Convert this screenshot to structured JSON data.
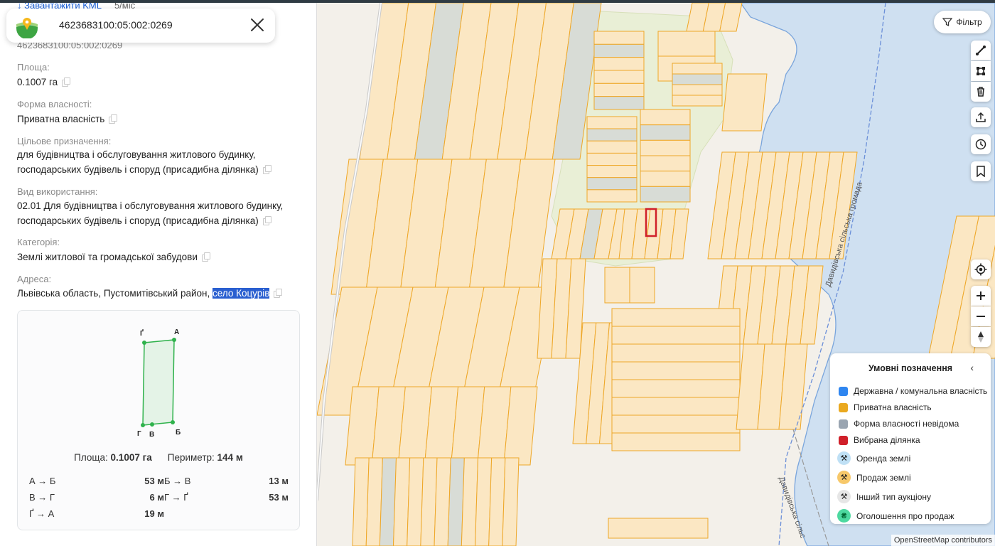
{
  "kml": {
    "label": "Завантажити KML",
    "extra": "5/міс"
  },
  "search": {
    "value": "4623683100:05:002:0269"
  },
  "cadastre_ghost": "4623683100:05:002:0269",
  "fields": [
    {
      "label": "Площа:",
      "value": "0.1007 га"
    },
    {
      "label": "Форма власності:",
      "value": "Приватна власність"
    },
    {
      "label": "Цільове призначення:",
      "value": "для будівництва і обслуговування житлового будинку, господарських будівель і споруд (присадибна ділянка)"
    },
    {
      "label": "Вид використання:",
      "value": "02.01 Для будівництва і обслуговування житлового будинку, господарських будівель і споруд (присадибна ділянка)"
    },
    {
      "label": "Категорія:",
      "value": "Землі житлової та громадської забудови"
    },
    {
      "label": "Адреса:",
      "value_prefix": "Львівська область, Пустомитівський район, ",
      "value_selected": "село Коцурів"
    }
  ],
  "plot": {
    "vertices": [
      "Ґ",
      "А",
      "Б",
      "В",
      "Г"
    ],
    "area_label": "Площа:",
    "area_value": "0.1007 га",
    "perimeter_label": "Периметр:",
    "perimeter_value": "144 м",
    "edges": [
      {
        "label": "А → Б",
        "value": "53 м"
      },
      {
        "label": "Б → В",
        "value": "13 м"
      },
      {
        "label": "В → Г",
        "value": "6 м"
      },
      {
        "label": "Г → Ґ",
        "value": "53 м"
      },
      {
        "label": "Ґ → А",
        "value": "19 м"
      }
    ]
  },
  "map": {
    "filter_label": "Фільтр",
    "road_labels": [
      "Давидівська сільська громада",
      "Давидівська сільс"
    ],
    "attribution": "OpenStreetMap contributors",
    "colors": {
      "parcel_fill": "#fbe7c3",
      "parcel_stroke": "#eea728",
      "selected": "#d0202a",
      "water": "#c6dcf2",
      "water_stroke": "#6b9ad8",
      "unknown_fill": "#d8dcd6"
    }
  },
  "legend": {
    "title": "Умовні позначення",
    "items": [
      {
        "label": "Державна / комунальна власність",
        "color": "#2f86f0"
      },
      {
        "label": "Приватна власність",
        "color": "#eaa920"
      },
      {
        "label": "Форма власності невідома",
        "color": "#9aa5b1"
      },
      {
        "label": "Вибрана ділянка",
        "color": "#d0202a"
      },
      {
        "label": "Оренда землі",
        "color": "#bfe0f5"
      },
      {
        "label": "Продаж землі",
        "color": "#f7c86a"
      },
      {
        "label": "Інший тип аукціону",
        "color": "#e6e6e6"
      },
      {
        "label": "Оголошення про продаж",
        "color": "#4dd9a0"
      }
    ]
  }
}
